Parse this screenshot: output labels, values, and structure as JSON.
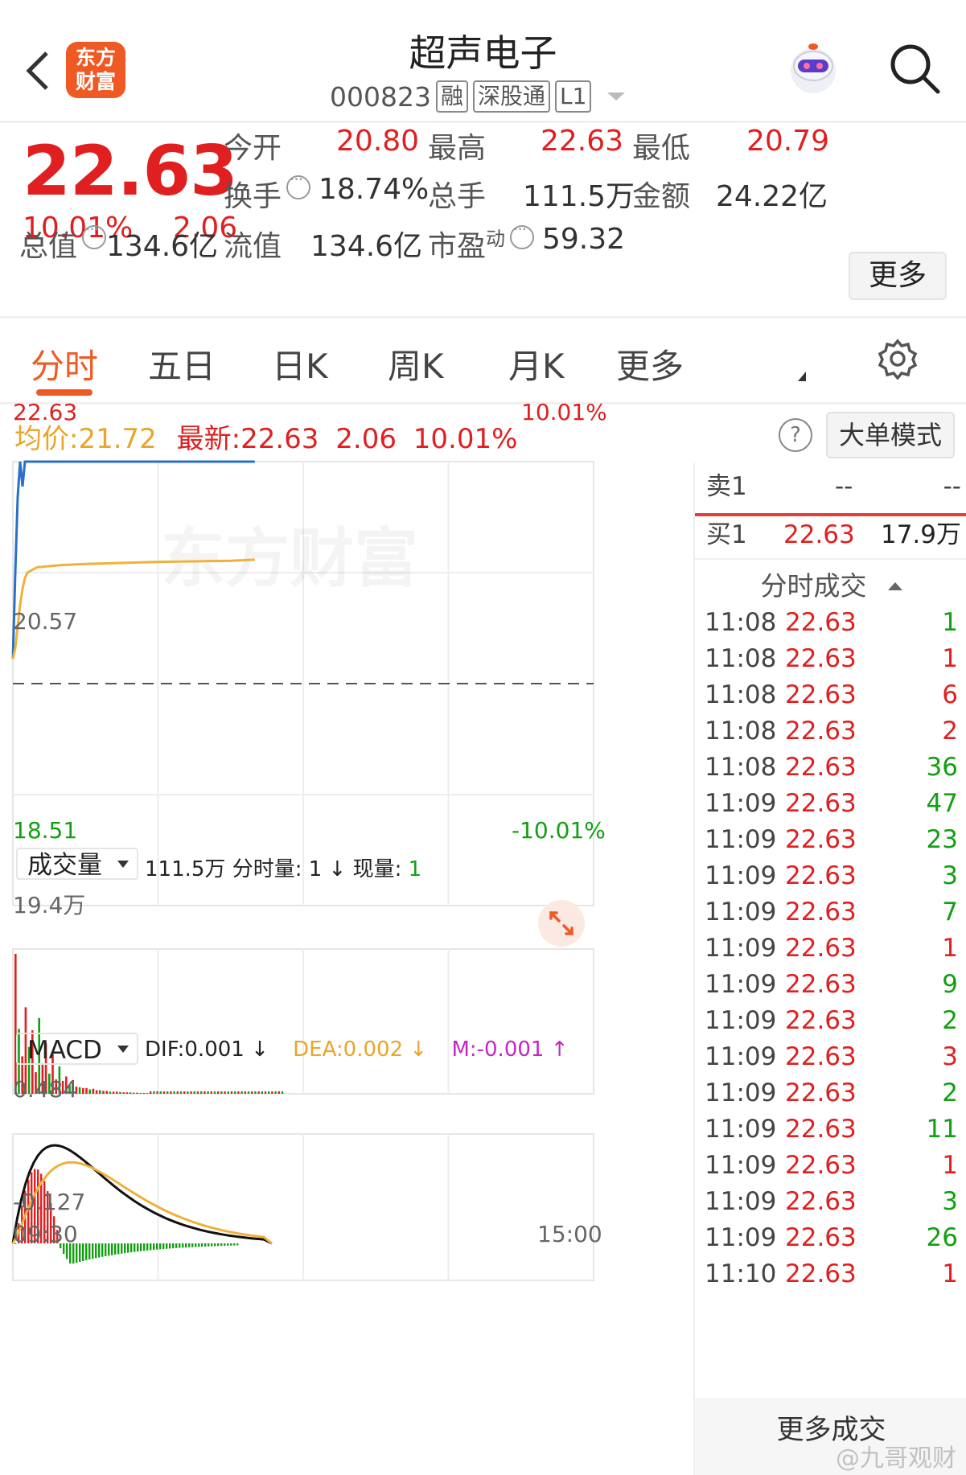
{
  "header": {
    "logo_line1": "东方",
    "logo_line2": "财富",
    "title": "超声电子",
    "code": "000823",
    "tags": [
      "融",
      "深股通",
      "L1"
    ]
  },
  "quote": {
    "price": "22.63",
    "pct": "10.01%",
    "change": "2.06",
    "rows": [
      {
        "label": "今开",
        "value": "20.80"
      },
      {
        "label": "最高",
        "value": "22.63"
      },
      {
        "label": "最低",
        "value": "20.79"
      },
      {
        "label": "换手",
        "value": "18.74%"
      },
      {
        "label": "总手",
        "value": "111.5万"
      },
      {
        "label": "金额",
        "value": "24.22亿"
      },
      {
        "label": "总值",
        "value": "134.6亿"
      },
      {
        "label": "流值",
        "value": "134.6亿"
      },
      {
        "label": "市盈",
        "sup": "动",
        "value": "59.32"
      }
    ],
    "more_label": "更多"
  },
  "tabs": [
    "分时",
    "五日",
    "日K",
    "周K",
    "月K",
    "更多"
  ],
  "infoline": {
    "avg_label": "均价:",
    "avg_value": "21.72",
    "latest_label": "最新:",
    "latest_price": "22.63",
    "latest_change": "2.06",
    "latest_pct": "10.01%",
    "help": "?",
    "mode_button": "大单模式"
  },
  "colors": {
    "up": "#e02020",
    "down": "#12a012",
    "price_line": "#2a6fc9",
    "avg_line": "#f0b13a",
    "accent": "#ef5a24"
  },
  "chart_data": [
    {
      "type": "line",
      "title": "",
      "series": [
        {
          "x": [
            "09:30",
            "09:31",
            "09:32",
            "09:33",
            "09:34",
            "09:35",
            "09:36",
            "09:40",
            "09:50",
            "10:00",
            "10:30",
            "11:00",
            "11:10"
          ],
          "values": [
            20.8,
            21.6,
            22.3,
            22.63,
            22.4,
            22.63,
            22.63,
            22.63,
            22.63,
            22.63,
            22.63,
            22.63,
            22.63
          ]
        },
        {
          "x": [
            "09:30",
            "09:31",
            "09:32",
            "09:33",
            "09:34",
            "09:35",
            "09:36",
            "09:40",
            "09:50",
            "10:00",
            "10:30",
            "11:00",
            "11:10"
          ],
          "values": [
            20.8,
            20.9,
            21.1,
            21.3,
            21.45,
            21.55,
            21.6,
            21.65,
            21.67,
            21.68,
            21.7,
            21.71,
            21.72
          ]
        }
      ],
      "ylim": [
        18.51,
        22.63
      ],
      "prev_close": "20.57",
      "y_top_label": "22.63",
      "y_mid_label": "20.57",
      "y_bottom_label": "18.51",
      "pct_top_label": "10.01%",
      "pct_bottom_label": "-10.01%"
    },
    {
      "type": "bar",
      "title": "",
      "selector_label": "成交量",
      "total": "111.5万",
      "detail_label": "分时量: 1 ↓ 现量:",
      "current": "1",
      "y_top_label": "19.4万",
      "values": [
        19.4,
        9.0,
        5.2,
        12.0,
        6.5,
        8.8,
        3.0,
        10.5,
        4.2,
        7.0,
        2.8,
        5.5,
        2.0,
        3.8,
        1.8,
        2.4,
        1.2,
        1.9,
        1.0,
        0.9,
        0.8,
        0.8,
        0.6,
        0.7,
        0.5,
        0.5,
        0.4,
        0.4,
        0.3,
        0.3,
        0.3,
        0.25,
        0.2,
        0.2,
        0.2,
        0.15,
        0.15,
        0.12,
        0.12,
        0.1
      ],
      "ylim": [
        0,
        19.4
      ]
    },
    {
      "type": "bar",
      "title": "",
      "selector_label": "MACD",
      "dif_label": "DIF:0.001 ↓",
      "dea_label": "DEA:0.002 ↓",
      "m_label": "M:-0.001 ↑",
      "y_top_label": "0.484",
      "y_bottom_label": "-0.127",
      "ylim": [
        -0.127,
        0.484
      ],
      "x_start": "09:30",
      "x_end": "15:00"
    }
  ],
  "book": {
    "sell_label": "卖1",
    "sell_price": "--",
    "sell_vol": "--",
    "buy_label": "买1",
    "buy_price": "22.63",
    "buy_vol": "17.9万",
    "trades_header": "分时成交",
    "trades": [
      {
        "time": "11:08",
        "price": "22.63",
        "vol": "1",
        "color": "green"
      },
      {
        "time": "11:08",
        "price": "22.63",
        "vol": "1",
        "color": "red"
      },
      {
        "time": "11:08",
        "price": "22.63",
        "vol": "6",
        "color": "red"
      },
      {
        "time": "11:08",
        "price": "22.63",
        "vol": "2",
        "color": "red"
      },
      {
        "time": "11:08",
        "price": "22.63",
        "vol": "36",
        "color": "green"
      },
      {
        "time": "11:09",
        "price": "22.63",
        "vol": "47",
        "color": "green"
      },
      {
        "time": "11:09",
        "price": "22.63",
        "vol": "23",
        "color": "green"
      },
      {
        "time": "11:09",
        "price": "22.63",
        "vol": "3",
        "color": "green"
      },
      {
        "time": "11:09",
        "price": "22.63",
        "vol": "7",
        "color": "green"
      },
      {
        "time": "11:09",
        "price": "22.63",
        "vol": "1",
        "color": "red"
      },
      {
        "time": "11:09",
        "price": "22.63",
        "vol": "9",
        "color": "green"
      },
      {
        "time": "11:09",
        "price": "22.63",
        "vol": "2",
        "color": "green"
      },
      {
        "time": "11:09",
        "price": "22.63",
        "vol": "3",
        "color": "red"
      },
      {
        "time": "11:09",
        "price": "22.63",
        "vol": "2",
        "color": "green"
      },
      {
        "time": "11:09",
        "price": "22.63",
        "vol": "11",
        "color": "green"
      },
      {
        "time": "11:09",
        "price": "22.63",
        "vol": "1",
        "color": "red"
      },
      {
        "time": "11:09",
        "price": "22.63",
        "vol": "3",
        "color": "green"
      },
      {
        "time": "11:09",
        "price": "22.63",
        "vol": "26",
        "color": "green"
      },
      {
        "time": "11:10",
        "price": "22.63",
        "vol": "1",
        "color": "red"
      }
    ],
    "more_trades": "更多成交"
  },
  "watermark": "@九哥观财",
  "chart_watermark": "东方财富"
}
